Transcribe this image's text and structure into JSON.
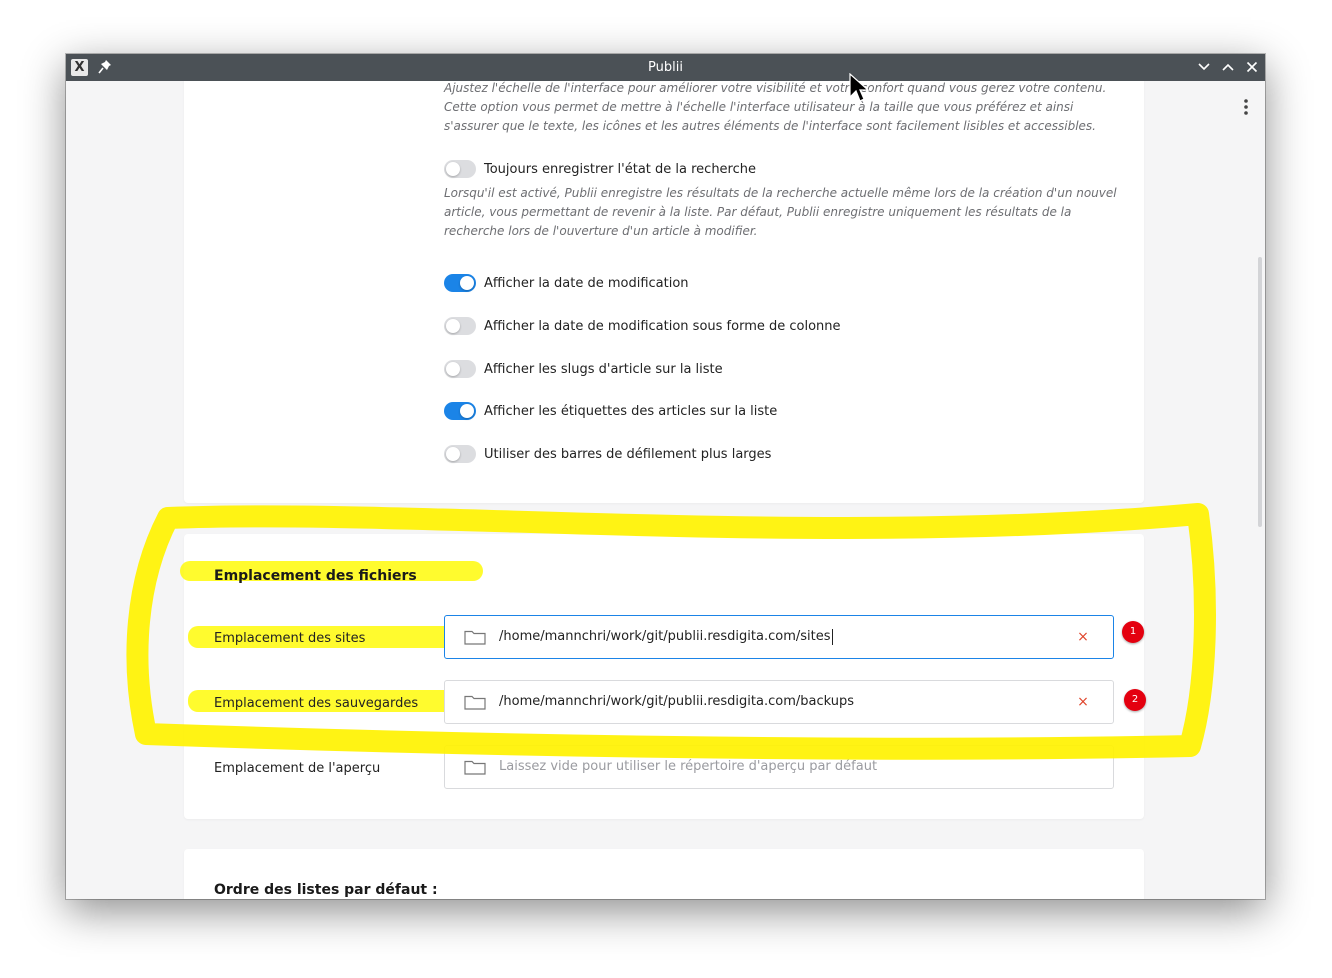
{
  "window": {
    "title": "Publii"
  },
  "interface_section": {
    "scale_description": "Ajustez l'échelle de l'interface pour améliorer votre visibilité et votre confort quand vous gerez votre contenu. Cette option vous permet de mettre à l'échelle l'interface utilisateur à la taille que vous préférez et ainsi s'assurer que le texte, les icônes et les autres éléments de l'interface sont facilement lisibles et accessibles.",
    "settings": [
      {
        "label": "Toujours enregistrer l'état de la recherche",
        "enabled": false
      },
      {
        "label": "Afficher la date de modification",
        "enabled": true
      },
      {
        "label": "Afficher la date de modification sous forme de colonne",
        "enabled": false
      },
      {
        "label": "Afficher les slugs d'article sur la liste",
        "enabled": false
      },
      {
        "label": "Afficher les étiquettes des articles sur la liste",
        "enabled": true
      },
      {
        "label": "Utiliser des barres de défilement plus larges",
        "enabled": false
      }
    ],
    "search_state_description": "Lorsqu'il est activé, Publii enregistre les résultats de la recherche actuelle même lors de la création d'un nouvel article, vous permettant de revenir à la liste. Par défaut, Publii enregistre uniquement les résultats de la recherche lors de l'ouverture d'un article à modifier."
  },
  "files_section": {
    "title": "Emplacement des fichiers",
    "sites": {
      "label": "Emplacement des sites",
      "value": "/home/mannchri/work/git/publii.resdigita.com/sites",
      "clear": "×"
    },
    "backups": {
      "label": "Emplacement des sauvegardes",
      "value": "/home/mannchri/work/git/publii.resdigita.com/backups",
      "clear": "×"
    },
    "preview": {
      "label": "Emplacement de l'aperçu",
      "placeholder": "Laissez vide pour utiliser le répertoire d'aperçu par défaut"
    }
  },
  "order_section": {
    "title": "Ordre des listes par défaut :"
  },
  "annotations": {
    "badge_1": "1",
    "badge_2": "2",
    "highlight_color": "#fff200"
  },
  "colors": {
    "accent": "#1b84e7",
    "titlebar": "#4b5156",
    "clear": "#e0452b",
    "badge": "#e4000f"
  },
  "icons": [
    "app-icon",
    "pin-icon",
    "minimize-icon",
    "maximize-icon",
    "close-icon",
    "kebab-icon",
    "folder-icon",
    "mouse-cursor-icon"
  ]
}
